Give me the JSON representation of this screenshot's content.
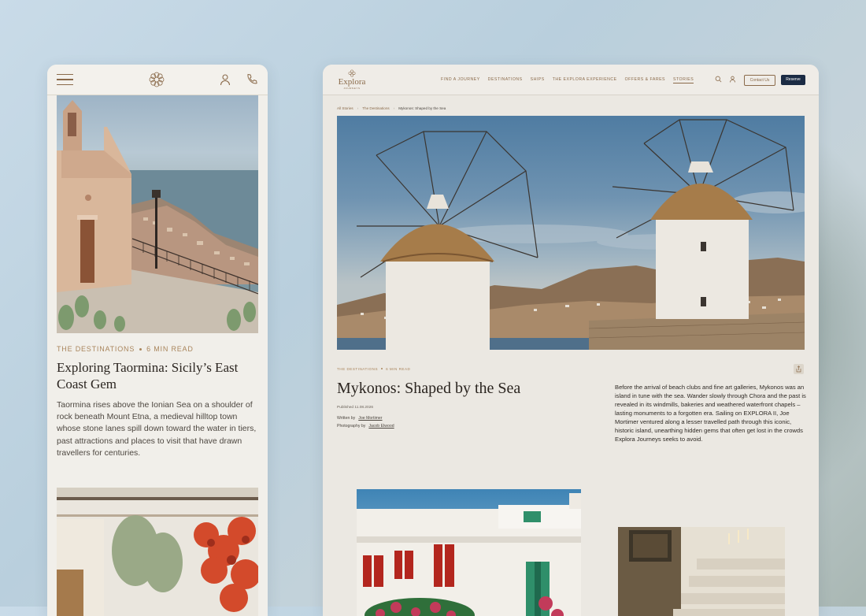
{
  "mobile": {
    "article": {
      "category": "THE DESTINATIONS",
      "read_time": "6 MIN READ",
      "title": "Exploring Taormina: Sicily’s East Coast Gem",
      "description": "Taormina rises above the Ionian Sea on a shoulder of rock beneath Mount Etna, a medieval hilltop town whose stone lanes spill down toward the water in tiers, past attractions and places to visit that have drawn travellers for centuries."
    }
  },
  "desktop": {
    "logo": {
      "word": "Explora",
      "sub": "JOURNEYS"
    },
    "nav": [
      {
        "label": "FIND A JOURNEY"
      },
      {
        "label": "DESTINATIONS"
      },
      {
        "label": "SHIPS"
      },
      {
        "label": "THE EXPLORA EXPERIENCE"
      },
      {
        "label": "OFFERS & FARES"
      },
      {
        "label": "STORIES"
      }
    ],
    "contact_label": "Contact Us",
    "reserve_label": "Reserve",
    "breadcrumb": [
      "All Stories",
      "The Destinations",
      "Mykonos: Shaped by the Sea"
    ],
    "breadcrumb_sep": "›",
    "article": {
      "category": "THE DESTINATIONS",
      "read_time": "6 MIN READ",
      "title": "Mykonos: Shaped by the Sea",
      "published": "Published 11.08.2026",
      "written_by_label": "Written by",
      "author": "Joe Mortimer",
      "photography_label": "Photography by",
      "photographer": "Jacob Elwood",
      "body": "Before the arrival of beach clubs and fine art galleries, Mykonos was an island in tune with the sea. Wander slowly through Chora and the past is revealed in its windmills, bakeries and weathered waterfront chapels – lasting monuments to a forgotten era. Sailing on EXPLORA II, Joe Mortimer ventured along a lesser travelled path through this iconic, historic island, unearthing hidden gems that often get lost in the crowds Explora Journeys seeks to avoid."
    }
  },
  "colors": {
    "accent": "#8a6a4a",
    "meta": "#a9855c",
    "reserve_bg": "#1b2b44",
    "page_bg": "#ebe8e2"
  }
}
